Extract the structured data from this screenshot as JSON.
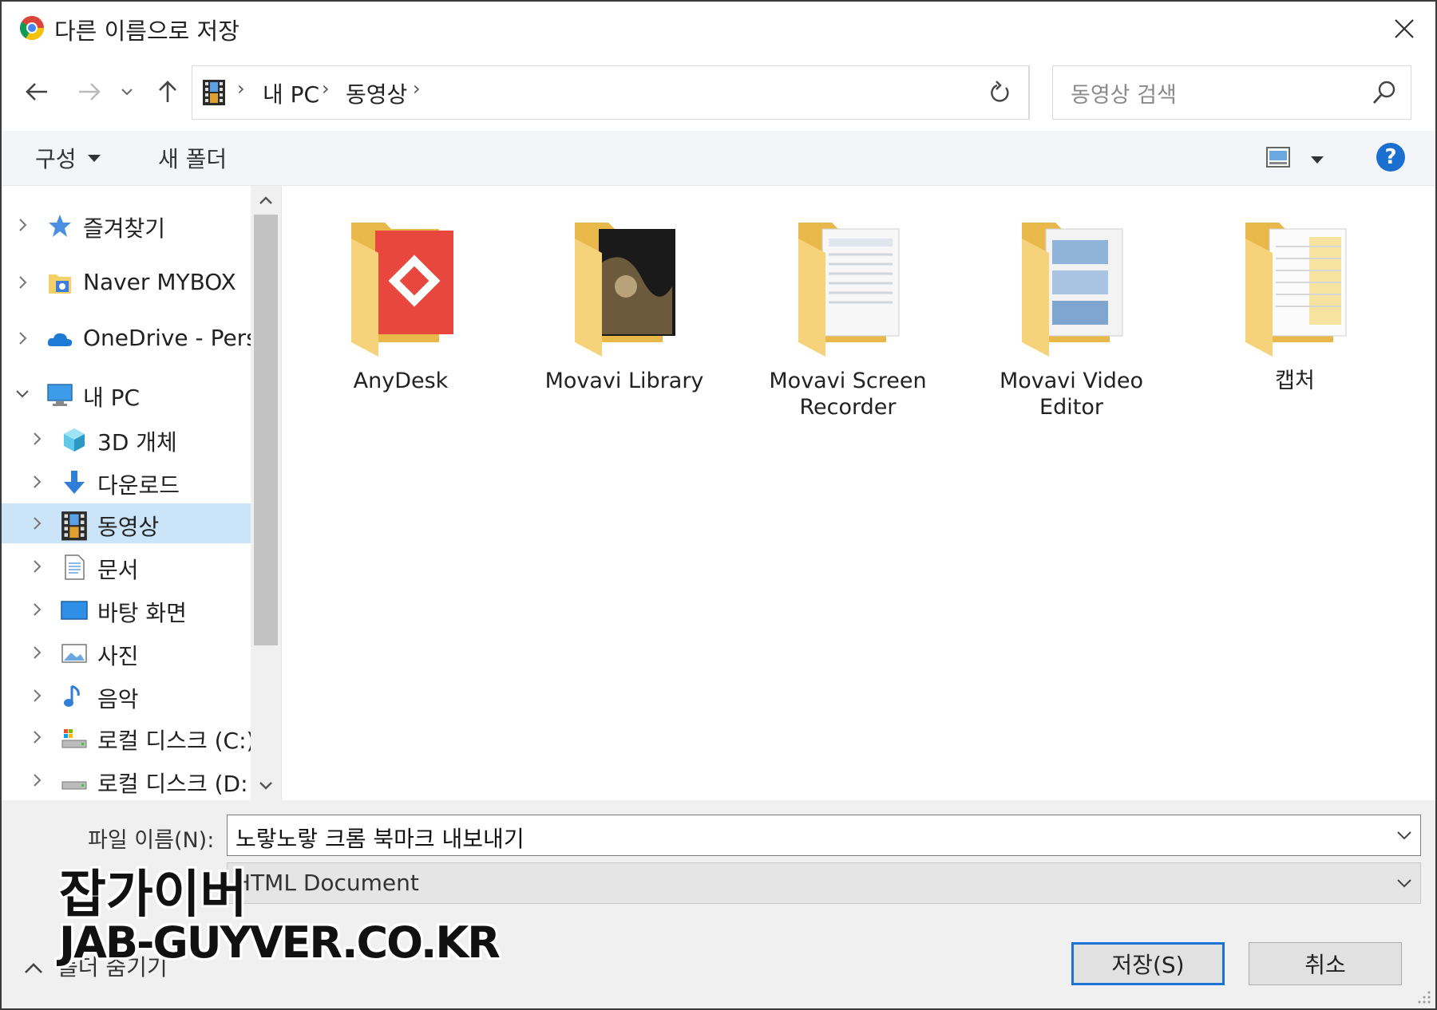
{
  "window": {
    "title": "다른 이름으로 저장",
    "app_icon": "chrome-icon",
    "close_icon": "close-icon"
  },
  "nav": {
    "back_icon": "arrow-left-icon",
    "forward_icon": "arrow-right-icon",
    "recent_icon": "chevron-down-icon",
    "up_icon": "arrow-up-icon",
    "breadcrumb": [
      "내 PC",
      "동영상"
    ],
    "refresh_icon": "refresh-icon",
    "search_placeholder": "동영상 검색"
  },
  "commandbar": {
    "organize_label": "구성",
    "new_folder_label": "새 폴더",
    "view_icon": "view-options-icon",
    "help_label": "?"
  },
  "sidebar": {
    "items": [
      {
        "label": "즐겨찾기",
        "icon": "star-icon",
        "expand": "collapsed",
        "level": 0
      },
      {
        "label": "Naver MYBOX",
        "icon": "mybox-icon",
        "expand": "collapsed",
        "level": 0
      },
      {
        "label": "OneDrive - Persor",
        "icon": "onedrive-icon",
        "expand": "collapsed",
        "level": 0
      },
      {
        "label": "내 PC",
        "icon": "pc-icon",
        "expand": "expanded",
        "level": 0
      },
      {
        "label": "3D 개체",
        "icon": "3d-objects-icon",
        "expand": "collapsed",
        "level": 1
      },
      {
        "label": "다운로드",
        "icon": "download-icon",
        "expand": "collapsed",
        "level": 1
      },
      {
        "label": "동영상",
        "icon": "video-icon",
        "expand": "collapsed",
        "level": 1,
        "selected": true
      },
      {
        "label": "문서",
        "icon": "document-icon",
        "expand": "collapsed",
        "level": 1
      },
      {
        "label": "바탕 화면",
        "icon": "desktop-icon",
        "expand": "collapsed",
        "level": 1
      },
      {
        "label": "사진",
        "icon": "pictures-icon",
        "expand": "collapsed",
        "level": 1
      },
      {
        "label": "음악",
        "icon": "music-icon",
        "expand": "collapsed",
        "level": 1
      },
      {
        "label": "로컬 디스크 (C:)",
        "icon": "drive-c-icon",
        "expand": "collapsed",
        "level": 1
      },
      {
        "label": "로컬 디스크 (D:",
        "icon": "drive-icon",
        "expand": "collapsed",
        "level": 1
      }
    ]
  },
  "content": {
    "items": [
      {
        "label": "AnyDesk",
        "icon": "anydesk-folder-icon"
      },
      {
        "label": "Movavi Library",
        "icon": "movavi-library-folder-icon"
      },
      {
        "label": "Movavi Screen Recorder",
        "icon": "movavi-screen-recorder-folder-icon"
      },
      {
        "label": "Movavi Video Editor",
        "icon": "movavi-video-editor-folder-icon"
      },
      {
        "label": "캡처",
        "icon": "capture-folder-icon"
      }
    ]
  },
  "save": {
    "filename_label": "파일 이름(N):",
    "filename_value": "노랗노랗 크롬 북마크 내보내기",
    "filetype_value": "HTML Document",
    "hide_folders_label": "폴더 숨기기",
    "save_button": "저장(S)",
    "cancel_button": "취소"
  },
  "watermark": {
    "line1": "잡가이버",
    "line2": "JAB-GUYVER.CO.KR"
  }
}
